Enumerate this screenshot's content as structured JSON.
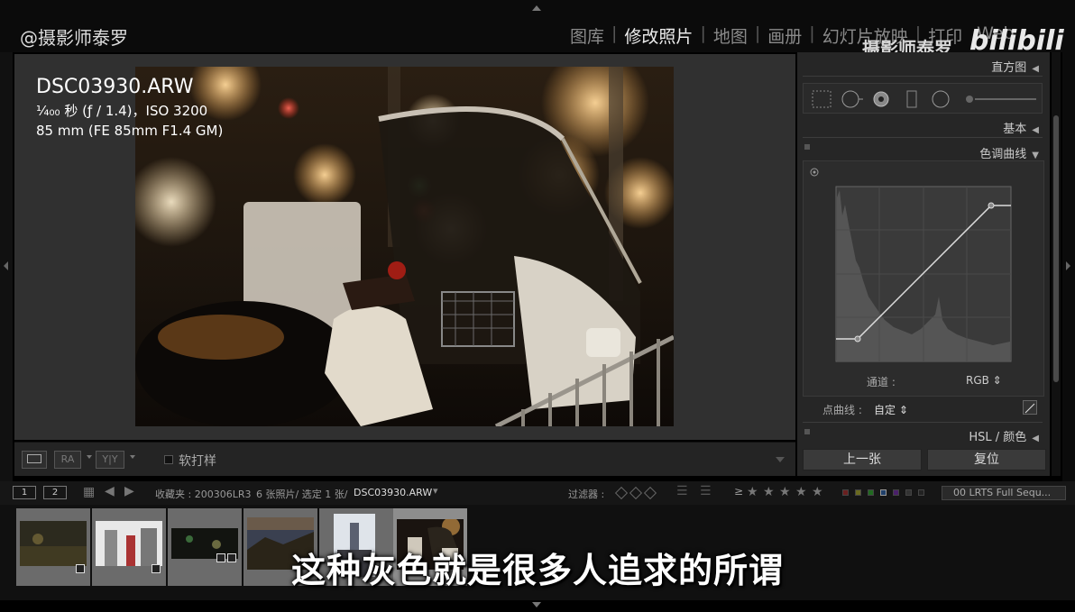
{
  "top": {
    "handle": "@摄影师泰罗",
    "modules": [
      "图库",
      "修改照片",
      "地图",
      "画册",
      "幻灯片放映",
      "打印",
      "Web"
    ],
    "active_module": "修改照片",
    "watermark": "摄影师泰罗",
    "bili_logo": "bilibili"
  },
  "photo": {
    "filename": "DSC03930.ARW",
    "exposure": "¹⁄₄₀₀ 秒 (ƒ / 1.4)，ISO 3200",
    "lens": "85 mm (FE 85mm F1.4 GM)"
  },
  "toolbar": {
    "view_ra": "RA",
    "view_yy": "Y|Y",
    "softproof_label": "软打样"
  },
  "right_panel": {
    "histogram": "直方图",
    "basic": "基本",
    "tone_curve": "色调曲线",
    "channel_label": "通道 :",
    "channel_value": "RGB ⇕",
    "point_curve_label": "点曲线 :",
    "point_curve_value": "自定 ⇕",
    "hsl": "HSL / 颜色",
    "prev_button": "上一张",
    "reset_button": "复位"
  },
  "filmstrip_bar": {
    "page1": "1",
    "page2": "2",
    "collection": "收藏夹 : 200306LR3",
    "count": "6 张照片/ 选定 1 张/",
    "selected_file": "DSC03930.ARW",
    "filter_label": "过滤器 :",
    "rating_op": "≥",
    "stars": [
      "★",
      "★",
      "★",
      "★",
      "★"
    ],
    "preset": "00 LRTS Full Sequ..."
  },
  "thumbnails": [
    {
      "id": "t1",
      "selected": false
    },
    {
      "id": "t2",
      "selected": false
    },
    {
      "id": "t3",
      "selected": false
    },
    {
      "id": "t4",
      "selected": false
    },
    {
      "id": "t5",
      "selected": false
    },
    {
      "id": "t6",
      "selected": true
    }
  ],
  "subtitle": "这种灰色就是很多人追求的所谓",
  "colors": {
    "accent": "#ededed",
    "panel": "#262626",
    "photo_bg": "#303030"
  }
}
